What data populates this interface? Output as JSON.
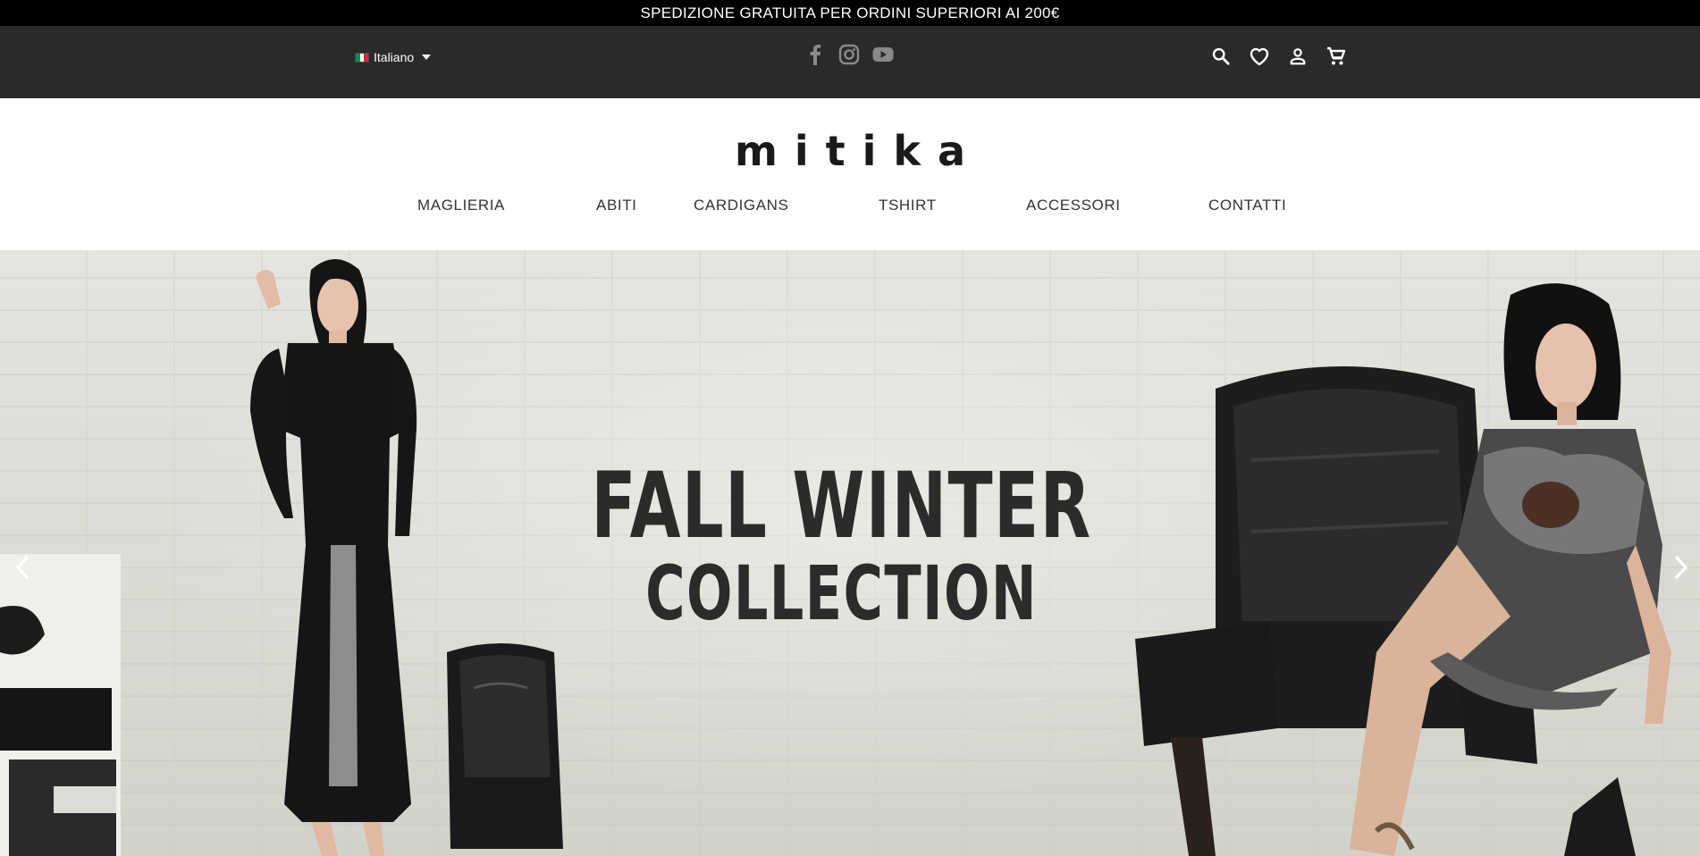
{
  "promo": {
    "text": "SPEDIZIONE GRATUITA PER ORDINI SUPERIORI AI 200€"
  },
  "header": {
    "language": {
      "label": "Italiano",
      "flag_colors": [
        "#009246",
        "#ffffff",
        "#ce2b37"
      ]
    },
    "social": [
      {
        "icon": "facebook-icon"
      },
      {
        "icon": "instagram-icon"
      },
      {
        "icon": "youtube-icon"
      }
    ],
    "tools": [
      {
        "icon": "search-icon"
      },
      {
        "icon": "heart-icon"
      },
      {
        "icon": "user-icon"
      },
      {
        "icon": "cart-icon"
      }
    ]
  },
  "brand": {
    "logo_text": "mitika"
  },
  "nav": {
    "items": [
      {
        "label": "MAGLIERIA"
      },
      {
        "label": "ABITI"
      },
      {
        "label": "CARDIGANS"
      },
      {
        "label": "TSHIRT"
      },
      {
        "label": "ACCESSORI"
      },
      {
        "label": "CONTATTI"
      }
    ]
  },
  "hero": {
    "title_line1": "FALL WINTER",
    "title_line2": "COLLECTION"
  },
  "colors": {
    "promo_bg": "#000000",
    "header_bg": "#2a2a2a",
    "social_icon": "#8a8a8a",
    "accent_text": "#222222"
  }
}
